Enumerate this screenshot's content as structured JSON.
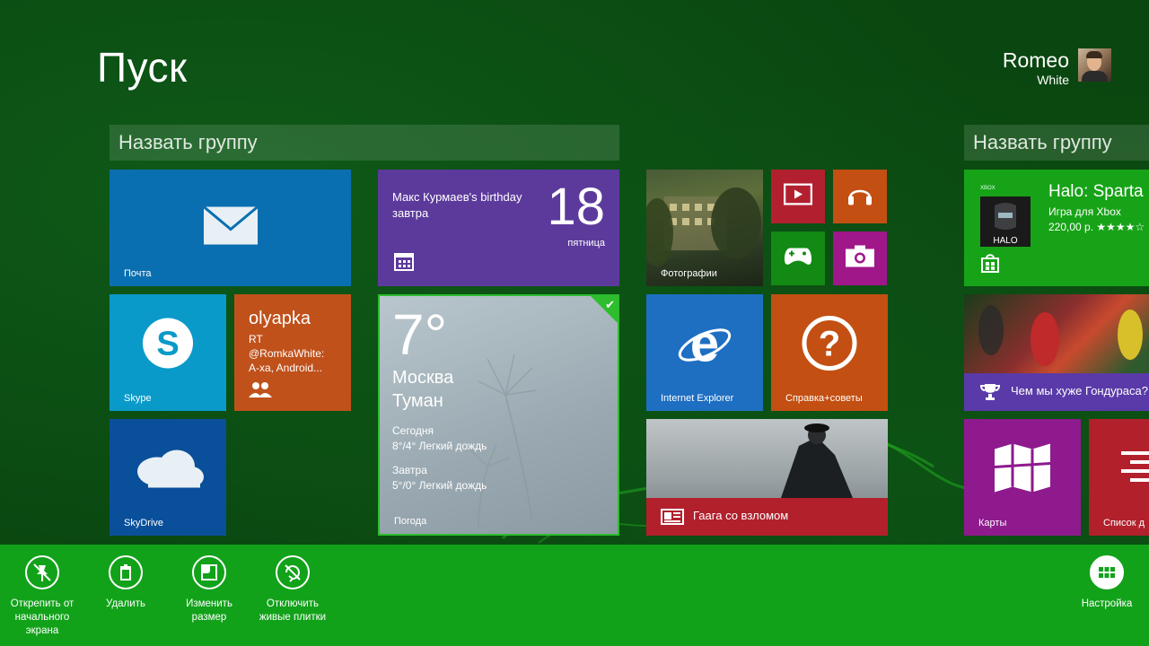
{
  "start": {
    "title": "Пуск"
  },
  "user": {
    "first": "Romeo",
    "last": "White"
  },
  "groups": [
    "Назвать группу",
    "Назвать группу"
  ],
  "tiles": {
    "mail": {
      "label": "Почта"
    },
    "calendar": {
      "event": "Макс Курмаев's birthday",
      "when": "завтра",
      "day_num": "18",
      "weekday": "пятница"
    },
    "skype": {
      "label": "Skype"
    },
    "people": {
      "name": "olyapka",
      "msg_line1": "RT",
      "msg_line2": "@RomkaWhite:",
      "msg_line3": "A-xa, Android..."
    },
    "skydrive": {
      "label": "SkyDrive"
    },
    "weather": {
      "temp": "7°",
      "city": "Москва",
      "condition": "Туман",
      "today_label": "Сегодня",
      "today": "8°/4° Легкий дождь",
      "tomorrow_label": "Завтра",
      "tomorrow": "5°/0° Легкий дождь",
      "label": "Погода"
    },
    "photos": {
      "label": "Фотографии"
    },
    "ie": {
      "label": "Internet Explorer"
    },
    "help": {
      "label": "Справка+советы"
    },
    "news": {
      "headline": "Гаага со взломом"
    },
    "halo": {
      "title": "Halo: Sparta",
      "sub": "Игра для Xbox",
      "price": "220,00 р. ★★★★☆",
      "badge": "XBOX",
      "logo": "HALO"
    },
    "sport": {
      "headline": "Чем мы хуже Гондураса?"
    },
    "maps": {
      "label": "Карты"
    },
    "list": {
      "label": "Список д"
    }
  },
  "appbar": {
    "unpin": "Открепить от начального экрана",
    "uninstall": "Удалить",
    "resize": "Изменить размер",
    "live_off": "Отключить живые плитки",
    "customize": "Настройка"
  },
  "colors": {
    "background": "#0a4710",
    "appbar": "#12a21a",
    "selection": "#2dbd2d"
  }
}
